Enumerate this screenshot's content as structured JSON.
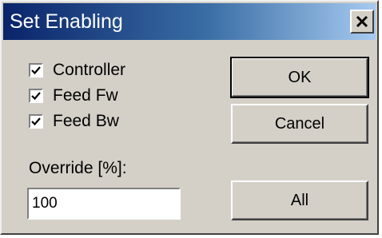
{
  "window": {
    "title": "Set Enabling",
    "close_icon": "close-x-icon"
  },
  "checkboxes": [
    {
      "label": "Controller",
      "checked": true
    },
    {
      "label": "Feed Fw",
      "checked": true
    },
    {
      "label": "Feed Bw",
      "checked": true
    }
  ],
  "override": {
    "label": "Override [%]:",
    "value": "100"
  },
  "buttons": {
    "ok_label": "OK",
    "cancel_label": "Cancel",
    "all_label": "All"
  },
  "colors": {
    "title_start": "#0a246a",
    "title_end": "#a6caf0",
    "face": "#d4d0c8"
  }
}
